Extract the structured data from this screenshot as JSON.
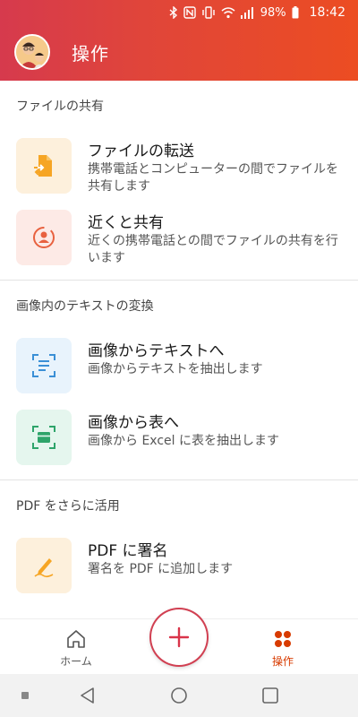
{
  "status_bar": {
    "battery_percent": "98%",
    "time": "18:42",
    "icons": [
      "bluetooth-icon",
      "nfc-icon",
      "vibrate-icon",
      "wifi-icon",
      "signal-icon",
      "battery-icon"
    ]
  },
  "header": {
    "title": "操作",
    "avatar_icon": "avatar-icon"
  },
  "colors": {
    "header_gradient_start": "#d63a4d",
    "header_gradient_end": "#ec4d22",
    "accent": "#d83b01"
  },
  "sections": [
    {
      "title": "ファイルの共有",
      "items": [
        {
          "title": "ファイルの転送",
          "desc": "携帯電話とコンピューターの間でファイルを共有します",
          "icon": "file-transfer-icon"
        },
        {
          "title": "近くと共有",
          "desc": "近くの携帯電話との間でファイルの共有を行います",
          "icon": "share-nearby-icon"
        }
      ]
    },
    {
      "title": "画像内のテキストの変換",
      "items": [
        {
          "title": "画像からテキストへ",
          "desc": "画像からテキストを抽出します",
          "icon": "image-to-text-icon"
        },
        {
          "title": "画像から表へ",
          "desc": "画像から Excel に表を抽出します",
          "icon": "image-to-table-icon"
        }
      ]
    },
    {
      "title": "PDF をさらに活用",
      "items": [
        {
          "title": "PDF に署名",
          "desc": "署名を PDF に追加します",
          "icon": "pdf-sign-icon"
        }
      ]
    }
  ],
  "bottom_nav": {
    "home_label": "ホーム",
    "actions_label": "操作",
    "create_icon": "plus-icon"
  }
}
